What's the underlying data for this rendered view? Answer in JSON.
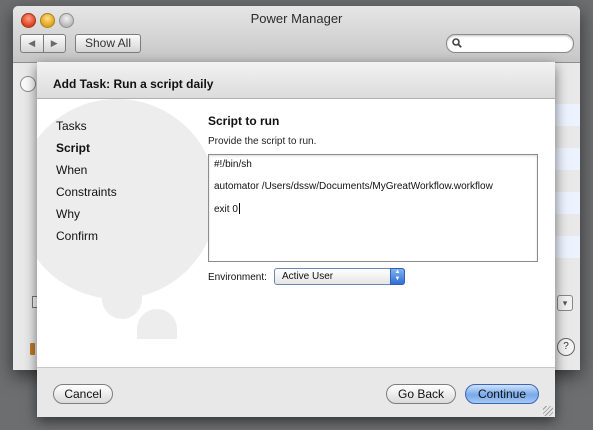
{
  "window": {
    "title": "Power Manager",
    "back_icon": "◀",
    "forward_icon": "▶",
    "show_all_label": "Show All",
    "search": {
      "value": "",
      "placeholder": ""
    }
  },
  "sheet": {
    "title": "Add Task: Run a script daily",
    "steps": [
      "Tasks",
      "Script",
      "When",
      "Constraints",
      "Why",
      "Confirm"
    ],
    "active_step": "Script",
    "content": {
      "heading": "Script to run",
      "description": "Provide the script to run.",
      "script_lines": [
        "#!/bin/sh",
        "automator /Users/dssw/Documents/MyGreatWorkflow.workflow",
        "exit 0"
      ],
      "environment_label": "Environment:",
      "environment_value": "Active User"
    },
    "buttons": {
      "cancel": "Cancel",
      "go_back": "Go Back",
      "continue": "Continue"
    }
  },
  "colors": {
    "accent": "#77a9ea",
    "row_stripe": "#edf3fe"
  }
}
